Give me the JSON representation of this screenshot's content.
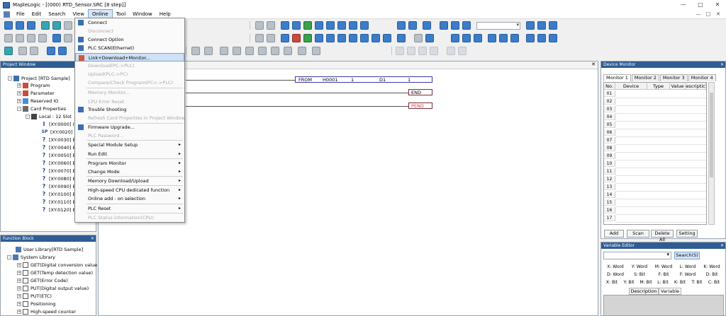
{
  "window": {
    "title": "MapleLogic - [(000) RTD_Sensor.SRC [8 step]]",
    "controls": [
      "—",
      "□",
      "✕"
    ]
  },
  "menubar": {
    "items": [
      "File",
      "Edit",
      "Search",
      "View",
      "Online",
      "Tool",
      "Window",
      "Help"
    ],
    "active": "Online",
    "mdi_controls": [
      "—",
      "□",
      "✕"
    ]
  },
  "online_menu": {
    "items": [
      {
        "label": "Connect",
        "enabled": true
      },
      {
        "label": "Disconnect",
        "enabled": false
      },
      {
        "label": "Connect Option",
        "enabled": true
      },
      {
        "label": "PLC SCAN(Ethernet)",
        "enabled": true
      },
      {
        "label": "Link+Download+Monitor...",
        "enabled": true,
        "highlighted": true
      },
      {
        "label": "Download(PC->PLC)",
        "enabled": false
      },
      {
        "label": "Upload(PLC->PC)",
        "enabled": false
      },
      {
        "label": "Compare/Check Program(PC<->PLC)",
        "enabled": false
      },
      {
        "label": "Memory Monitor...",
        "enabled": false
      },
      {
        "label": "CPU Error Reset",
        "enabled": false
      },
      {
        "label": "Trouble Shooting",
        "enabled": true
      },
      {
        "label": "Refresh Card Properties in Project Window",
        "enabled": false
      },
      {
        "label": "Firmware Upgrade...",
        "enabled": true
      },
      {
        "label": "PLC Password...",
        "enabled": false
      },
      {
        "label": "Special Module Setup",
        "enabled": true,
        "submenu": true
      },
      {
        "label": "Run Edit",
        "enabled": true,
        "submenu": true
      },
      {
        "label": "Program Monitor",
        "enabled": true,
        "submenu": true
      },
      {
        "label": "Change Mode",
        "enabled": true,
        "submenu": true
      },
      {
        "label": "Memory Download/Upload",
        "enabled": true,
        "submenu": true
      },
      {
        "label": "High-speed CPU dedicated function",
        "enabled": true,
        "submenu": true
      },
      {
        "label": "Online add - on selection",
        "enabled": true,
        "submenu": true
      },
      {
        "label": "PLC Reset",
        "enabled": true,
        "submenu": true
      },
      {
        "label": "PLC Status information(CPU)",
        "enabled": false
      }
    ]
  },
  "project_window": {
    "title": "Project Window",
    "tree": [
      {
        "label": "Project [RTD Sample]",
        "icon": "project-icon"
      },
      {
        "label": "Program",
        "icon": "program-icon"
      },
      {
        "label": "Parameter",
        "icon": "parameter-icon"
      },
      {
        "label": "Reserved IO",
        "icon": "reserved-io-icon"
      },
      {
        "label": "Card Properties",
        "icon": "card-icon"
      },
      {
        "label": "Local : 12 Slot",
        "icon": "local-slot-icon"
      },
      {
        "label": "[XY:0000] I",
        "icon": "io-icon"
      },
      {
        "label": "[XY:0020] E",
        "icon": "sp-icon"
      },
      {
        "label": "[XY:0030] E",
        "icon": "question-icon"
      },
      {
        "label": "[XY:0040] E",
        "icon": "question-icon"
      },
      {
        "label": "[XY:0050] E",
        "icon": "question-icon"
      },
      {
        "label": "[XY:0060] E",
        "icon": "question-icon"
      },
      {
        "label": "[XY:0070] E",
        "icon": "question-icon"
      },
      {
        "label": "[XY:0080] E",
        "icon": "question-icon"
      },
      {
        "label": "[XY:0090] E",
        "icon": "question-icon"
      },
      {
        "label": "[XY:0100] E",
        "icon": "question-icon"
      },
      {
        "label": "[XY:0110] E",
        "icon": "question-icon"
      },
      {
        "label": "[XY:0120] E",
        "icon": "question-icon"
      }
    ]
  },
  "function_block": {
    "title": "Function Block",
    "tree": [
      "User Library[RTD Sample]",
      "System Library",
      "GET(Digital conversion value",
      "GET(Temp detection value)",
      "GET(Error Code)",
      "PUT(Digital output value)",
      "PUT(ETC)",
      "Positioning",
      "High-speed counter"
    ]
  },
  "ladder": {
    "from_instruction": [
      "FROM",
      "H0001",
      "1",
      "D1",
      "1"
    ],
    "end_label": "END",
    "pend_label": "PEND"
  },
  "device_monitor": {
    "title": "Device Monitor",
    "tabs": [
      "Monitor 1",
      "Monitor 2",
      "Monitor 3",
      "Monitor 4"
    ],
    "active_tab": "Monitor 1",
    "columns": [
      "No.",
      "Device",
      "Type",
      "Value",
      "escriptic"
    ],
    "rows": [
      "01",
      "02",
      "03",
      "04",
      "05",
      "06",
      "07",
      "08",
      "09",
      "10",
      "11",
      "12",
      "13",
      "14",
      "15",
      "16",
      "17"
    ],
    "buttons": [
      "Add",
      "Scan",
      "Delete All",
      "Setting"
    ]
  },
  "variable_editor": {
    "title": "Variable Editor",
    "search_button": "Search(S)",
    "device_types": [
      [
        "X: Word",
        "Y: Word",
        "M: Word",
        "L: Word",
        "K: Word"
      ],
      [
        "D: Word",
        "S: Bit",
        "F: Bit",
        "F: Word",
        "D: Bit"
      ],
      [
        "X: Bit",
        "Y: Bit",
        "M: Bit",
        "L: Bit",
        "K: Bit",
        "T: Bit",
        "C: Bit"
      ]
    ],
    "tabs": [
      "Description",
      "Variable"
    ]
  },
  "colors": {
    "panel_title_bg": "#2f5d93",
    "menu_highlight": "#cfe1f6",
    "ladder_box_border": "#7a2a3a",
    "pend_text": "#d04040"
  }
}
